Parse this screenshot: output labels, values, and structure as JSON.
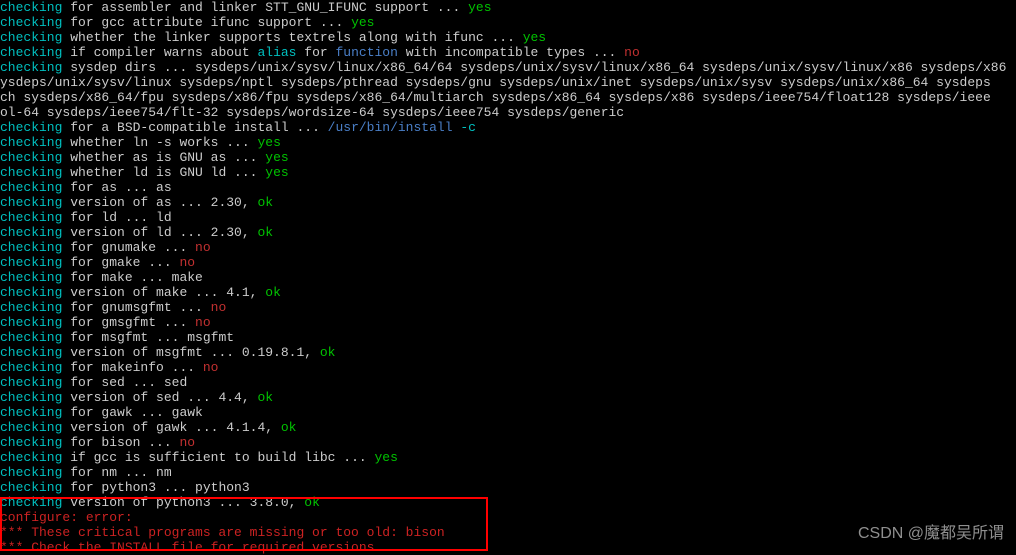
{
  "lines": [
    {
      "segments": [
        {
          "cls": "checking",
          "t": "checking"
        },
        {
          "t": " for assembler and linker STT_GNU_IFUNC support ... "
        },
        {
          "cls": "yes",
          "t": "yes"
        }
      ]
    },
    {
      "segments": [
        {
          "cls": "checking",
          "t": "checking"
        },
        {
          "t": " for gcc attribute ifunc support ... "
        },
        {
          "cls": "yes",
          "t": "yes"
        }
      ]
    },
    {
      "segments": [
        {
          "cls": "checking",
          "t": "checking"
        },
        {
          "t": " whether the linker supports textrels along with ifunc ... "
        },
        {
          "cls": "yes",
          "t": "yes"
        }
      ]
    },
    {
      "segments": [
        {
          "cls": "checking",
          "t": "checking"
        },
        {
          "t": " if compiler warns about "
        },
        {
          "cls": "alias",
          "t": "alias"
        },
        {
          "t": " for "
        },
        {
          "cls": "func",
          "t": "function"
        },
        {
          "t": " with incompatible types ... "
        },
        {
          "cls": "no",
          "t": "no"
        }
      ]
    },
    {
      "segments": [
        {
          "cls": "checking",
          "t": "checking"
        },
        {
          "t": " sysdep dirs ... sysdeps/unix/sysv/linux/x86_64/64 sysdeps/unix/sysv/linux/x86_64 sysdeps/unix/sysv/linux/x86 sysdeps/x86"
        }
      ]
    },
    {
      "segments": [
        {
          "t": "ysdeps/unix/sysv/linux sysdeps/nptl sysdeps/pthread sysdeps/gnu sysdeps/unix/inet sysdeps/unix/sysv sysdeps/unix/x86_64 sysdeps"
        }
      ]
    },
    {
      "segments": [
        {
          "t": "ch sysdeps/x86_64/fpu sysdeps/x86/fpu sysdeps/x86_64/multiarch sysdeps/x86_64 sysdeps/x86 sysdeps/ieee754/float128 sysdeps/ieee"
        }
      ]
    },
    {
      "segments": [
        {
          "t": "ol-64 sysdeps/ieee754/flt-32 sysdeps/wordsize-64 sysdeps/ieee754 sysdeps/generic"
        }
      ]
    },
    {
      "segments": [
        {
          "cls": "checking",
          "t": "checking"
        },
        {
          "t": " for a BSD-compatible install ... "
        },
        {
          "cls": "path",
          "t": "/usr/bin/install"
        },
        {
          "t": " "
        },
        {
          "cls": "flag",
          "t": "-c"
        }
      ]
    },
    {
      "segments": [
        {
          "cls": "checking",
          "t": "checking"
        },
        {
          "t": " whether ln -s works ... "
        },
        {
          "cls": "yes",
          "t": "yes"
        }
      ]
    },
    {
      "segments": [
        {
          "cls": "checking",
          "t": "checking"
        },
        {
          "t": " whether as is GNU as ... "
        },
        {
          "cls": "yes",
          "t": "yes"
        }
      ]
    },
    {
      "segments": [
        {
          "cls": "checking",
          "t": "checking"
        },
        {
          "t": " whether ld is GNU ld ... "
        },
        {
          "cls": "yes",
          "t": "yes"
        }
      ]
    },
    {
      "segments": [
        {
          "cls": "checking",
          "t": "checking"
        },
        {
          "t": " for as ... as"
        }
      ]
    },
    {
      "segments": [
        {
          "cls": "checking",
          "t": "checking"
        },
        {
          "t": " version of as ... 2.30, "
        },
        {
          "cls": "ok",
          "t": "ok"
        }
      ]
    },
    {
      "segments": [
        {
          "cls": "checking",
          "t": "checking"
        },
        {
          "t": " for ld ... ld"
        }
      ]
    },
    {
      "segments": [
        {
          "cls": "checking",
          "t": "checking"
        },
        {
          "t": " version of ld ... 2.30, "
        },
        {
          "cls": "ok",
          "t": "ok"
        }
      ]
    },
    {
      "segments": [
        {
          "cls": "checking",
          "t": "checking"
        },
        {
          "t": " for gnumake ... "
        },
        {
          "cls": "no",
          "t": "no"
        }
      ]
    },
    {
      "segments": [
        {
          "cls": "checking",
          "t": "checking"
        },
        {
          "t": " for gmake ... "
        },
        {
          "cls": "no",
          "t": "no"
        }
      ]
    },
    {
      "segments": [
        {
          "cls": "checking",
          "t": "checking"
        },
        {
          "t": " for make ... make"
        }
      ]
    },
    {
      "segments": [
        {
          "cls": "checking",
          "t": "checking"
        },
        {
          "t": " version of make ... 4.1, "
        },
        {
          "cls": "ok",
          "t": "ok"
        }
      ]
    },
    {
      "segments": [
        {
          "cls": "checking",
          "t": "checking"
        },
        {
          "t": " for gnumsgfmt ... "
        },
        {
          "cls": "no",
          "t": "no"
        }
      ]
    },
    {
      "segments": [
        {
          "cls": "checking",
          "t": "checking"
        },
        {
          "t": " for gmsgfmt ... "
        },
        {
          "cls": "no",
          "t": "no"
        }
      ]
    },
    {
      "segments": [
        {
          "cls": "checking",
          "t": "checking"
        },
        {
          "t": " for msgfmt ... msgfmt"
        }
      ]
    },
    {
      "segments": [
        {
          "cls": "checking",
          "t": "checking"
        },
        {
          "t": " version of msgfmt ... 0.19.8.1, "
        },
        {
          "cls": "ok",
          "t": "ok"
        }
      ]
    },
    {
      "segments": [
        {
          "cls": "checking",
          "t": "checking"
        },
        {
          "t": " for makeinfo ... "
        },
        {
          "cls": "no",
          "t": "no"
        }
      ]
    },
    {
      "segments": [
        {
          "cls": "checking",
          "t": "checking"
        },
        {
          "t": " for sed ... sed"
        }
      ]
    },
    {
      "segments": [
        {
          "cls": "checking",
          "t": "checking"
        },
        {
          "t": " version of sed ... 4.4, "
        },
        {
          "cls": "ok",
          "t": "ok"
        }
      ]
    },
    {
      "segments": [
        {
          "cls": "checking",
          "t": "checking"
        },
        {
          "t": " for gawk ... gawk"
        }
      ]
    },
    {
      "segments": [
        {
          "cls": "checking",
          "t": "checking"
        },
        {
          "t": " version of gawk ... 4.1.4, "
        },
        {
          "cls": "ok",
          "t": "ok"
        }
      ]
    },
    {
      "segments": [
        {
          "cls": "checking",
          "t": "checking"
        },
        {
          "t": " for bison ... "
        },
        {
          "cls": "no",
          "t": "no"
        }
      ]
    },
    {
      "segments": [
        {
          "cls": "checking",
          "t": "checking"
        },
        {
          "t": " if gcc is sufficient to build libc ... "
        },
        {
          "cls": "yes",
          "t": "yes"
        }
      ]
    },
    {
      "segments": [
        {
          "cls": "checking",
          "t": "checking"
        },
        {
          "t": " for nm ... nm"
        }
      ]
    },
    {
      "segments": [
        {
          "cls": "checking",
          "t": "checking"
        },
        {
          "t": " for python3 ... python3"
        }
      ]
    },
    {
      "segments": [
        {
          "cls": "checking",
          "t": "checking"
        },
        {
          "t": " version of python3 ... 3.8.0, "
        },
        {
          "cls": "ok",
          "t": "ok"
        }
      ]
    },
    {
      "segments": [
        {
          "cls": "err",
          "t": "configure: error:"
        }
      ]
    },
    {
      "segments": [
        {
          "cls": "err",
          "t": "*** These critical programs are missing or too old: bison"
        }
      ]
    },
    {
      "segments": [
        {
          "cls": "err",
          "t": "*** Check the INSTALL file for required versions."
        }
      ]
    }
  ],
  "watermark": "CSDN @魔都吴所谓"
}
